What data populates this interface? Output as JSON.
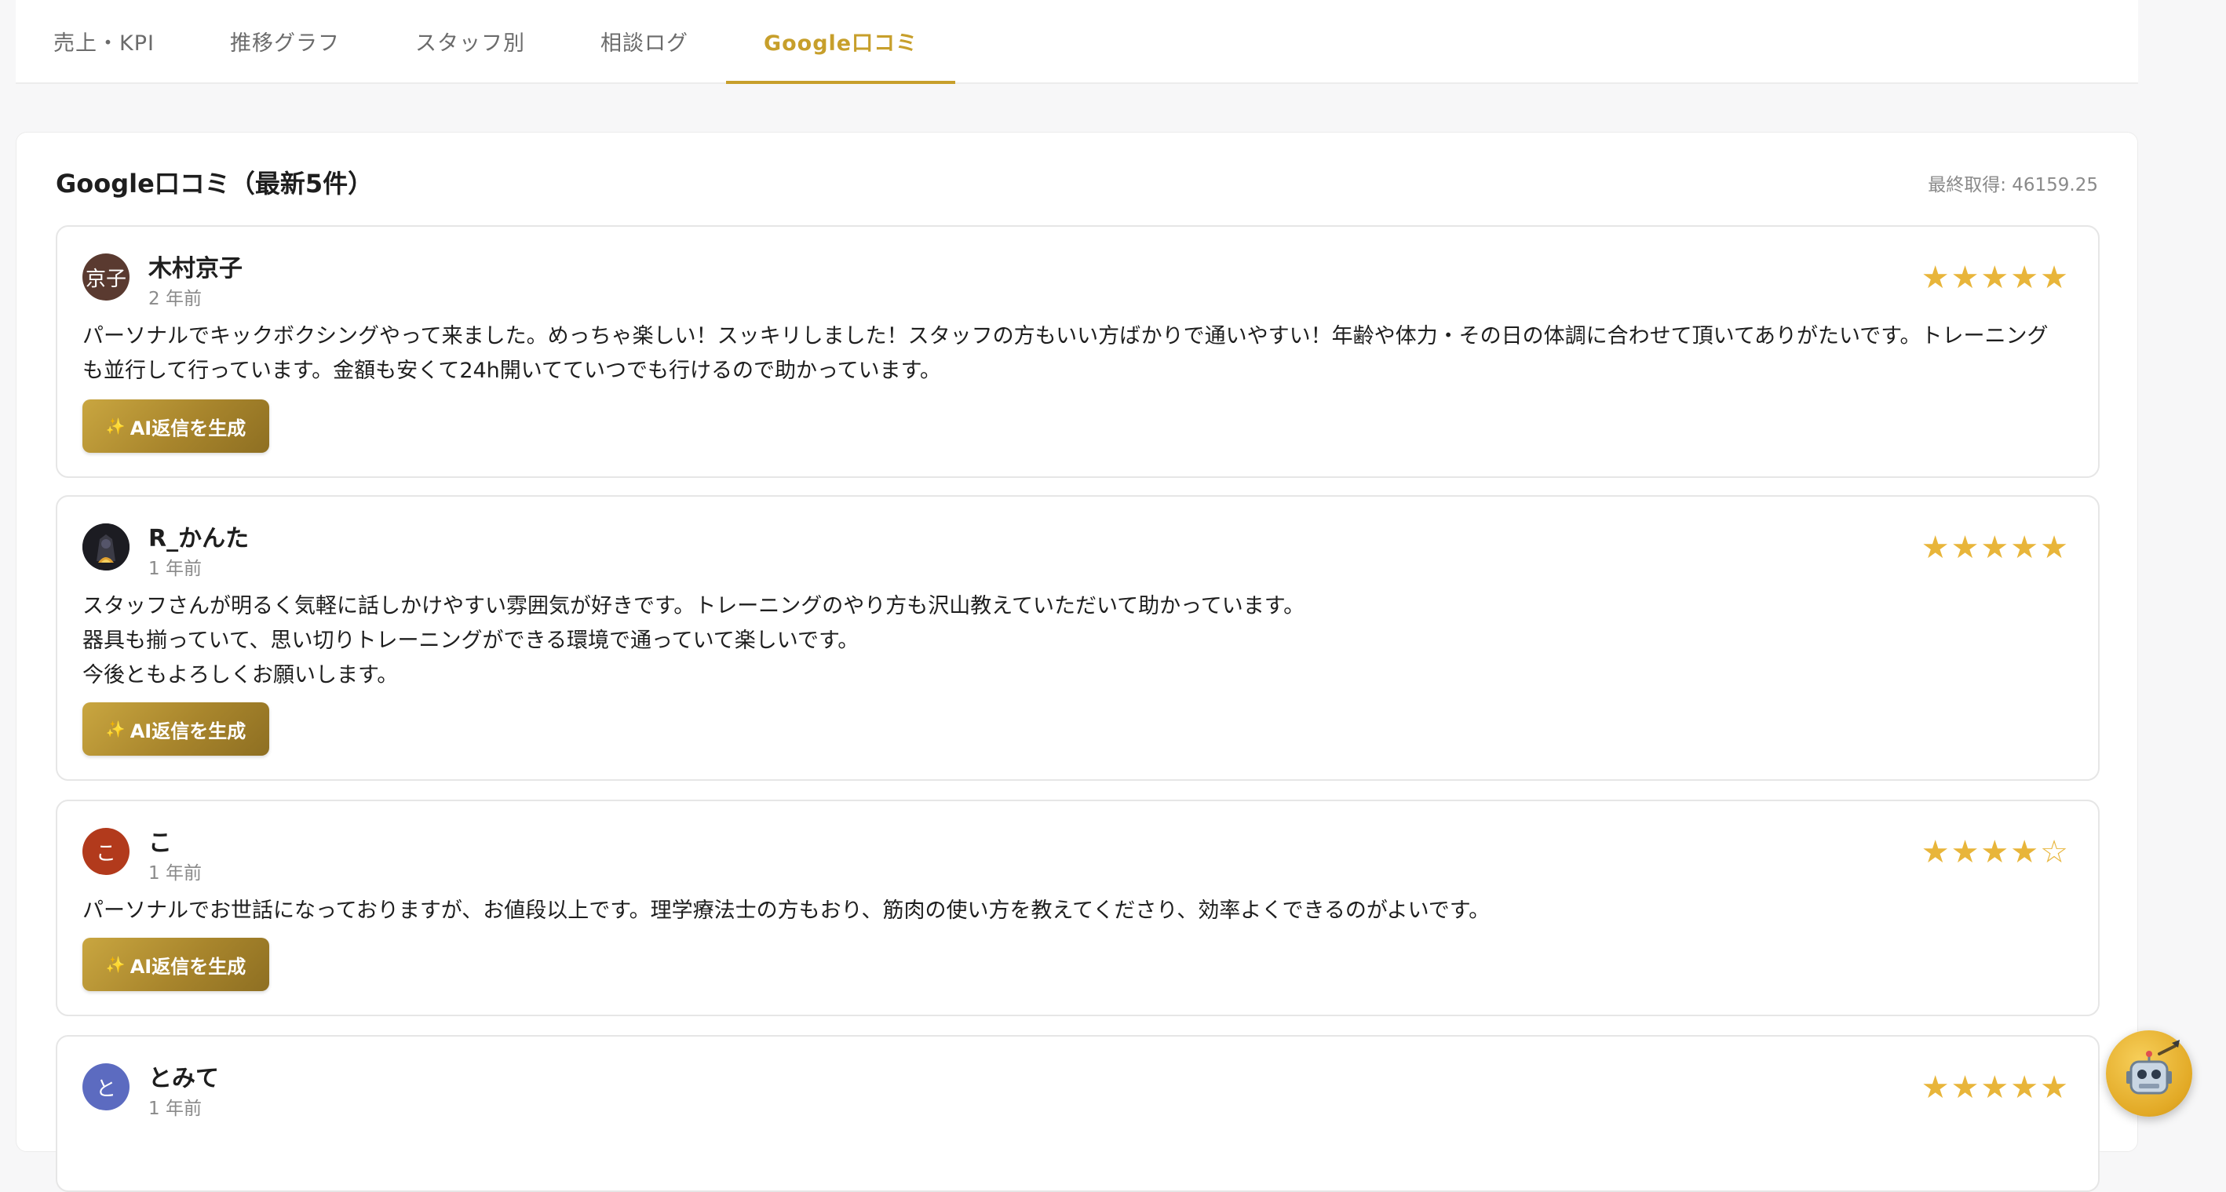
{
  "tabs": [
    {
      "label": "売上・KPI",
      "active": false
    },
    {
      "label": "推移グラフ",
      "active": false
    },
    {
      "label": "スタッフ別",
      "active": false
    },
    {
      "label": "相談ログ",
      "active": false
    },
    {
      "label": "Google口コミ",
      "active": true
    }
  ],
  "panel": {
    "title": "Google口コミ（最新5件）",
    "last_fetched": "最終取得: 46159.25"
  },
  "ai_button_label": "AI返信を生成",
  "ai_button_icon": "sparkles-icon",
  "colors": {
    "accent": "#c79f2b",
    "star": "#e8b53a"
  },
  "reviews": [
    {
      "name": "木村京子",
      "time": "2 年前",
      "avatar_text": "京子",
      "avatar_color": "#5a3a30",
      "stars": "★★★★★",
      "rating": 5,
      "text": "パーソナルでキックボクシングやって来ました。めっちゃ楽しい！スッキリしました！スタッフの方もいい方ばかりで通いやすい！年齢や体力・その日の体調に合わせて頂いてありがたいです。トレーニングも並行して行っています。金額も安くて24h開いてていつでも行けるので助かっています。"
    },
    {
      "name": "R_かんた",
      "time": "1 年前",
      "avatar_text": "",
      "avatar_color": "#1f1f24",
      "stars": "★★★★★",
      "rating": 5,
      "text": "スタッフさんが明るく気軽に話しかけやすい雰囲気が好きです。トレーニングのやり方も沢山教えていただいて助かっています。\n器具も揃っていて、思い切りトレーニングができる環境で通っていて楽しいです。\n今後ともよろしくお願いします。"
    },
    {
      "name": "こ",
      "time": "1 年前",
      "avatar_text": "こ",
      "avatar_color": "#b23a1c",
      "stars": "★★★★☆",
      "rating": 4,
      "text": "パーソナルでお世話になっておりますが、お値段以上です。理学療法士の方もおり、筋肉の使い方を教えてくださり、効率よくできるのがよいです。"
    },
    {
      "name": "とみて",
      "time": "1 年前",
      "avatar_text": "と",
      "avatar_color": "#5c6bc0",
      "stars": "★★★★★",
      "rating": 5,
      "text": ""
    }
  ]
}
